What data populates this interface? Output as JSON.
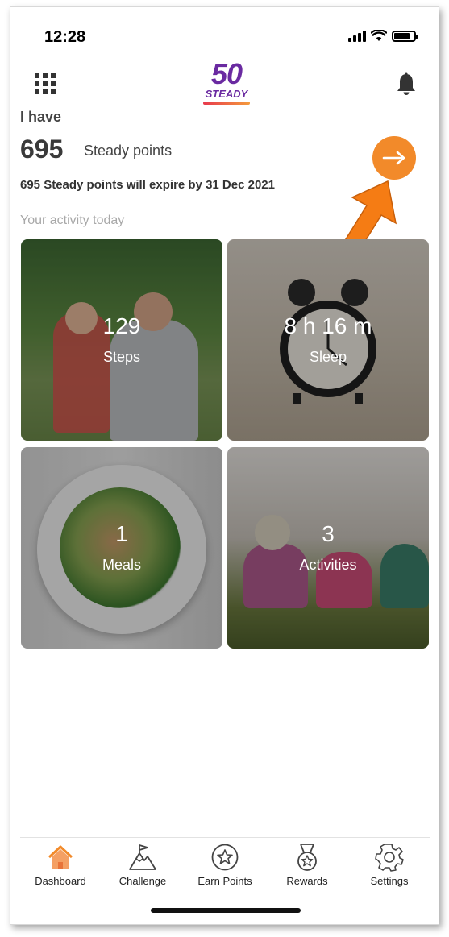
{
  "status_bar": {
    "time": "12:28"
  },
  "header": {
    "logo_number": "50",
    "logo_word": "STEADY"
  },
  "points": {
    "intro": "I have",
    "value": "695",
    "label": "Steady points",
    "expiry_text": "695 Steady points will expire by 31 Dec 2021"
  },
  "activity": {
    "heading": "Your activity today",
    "tiles": [
      {
        "value": "129",
        "label": "Steps"
      },
      {
        "value": "8 h 16 m",
        "label": "Sleep"
      },
      {
        "value": "1",
        "label": "Meals"
      },
      {
        "value": "3",
        "label": "Activities"
      }
    ]
  },
  "nav": {
    "items": [
      {
        "label": "Dashboard",
        "icon": "home-icon"
      },
      {
        "label": "Challenge",
        "icon": "mountain-flag-icon"
      },
      {
        "label": "Earn Points",
        "icon": "star-circle-icon"
      },
      {
        "label": "Rewards",
        "icon": "medal-icon"
      },
      {
        "label": "Settings",
        "icon": "gear-icon"
      }
    ]
  },
  "colors": {
    "accent_orange": "#f28a2a",
    "brand_purple": "#6a2aa1",
    "annotation_arrow": "#f57c14"
  }
}
